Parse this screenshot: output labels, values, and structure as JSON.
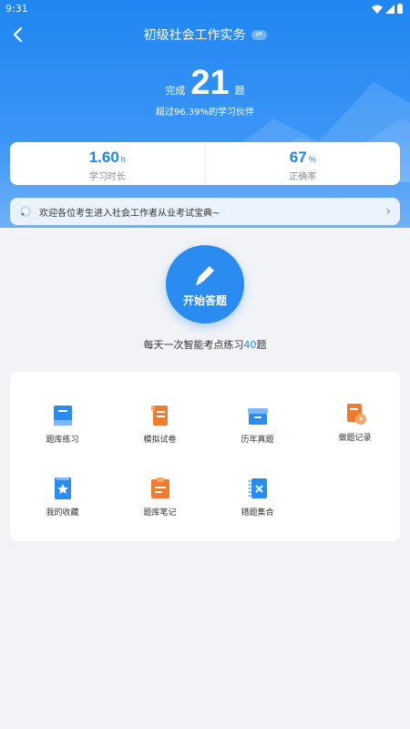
{
  "status_bar": {
    "time": "9:31"
  },
  "header": {
    "title": "初级社会工作实务",
    "swap_icon": "⇌"
  },
  "progress": {
    "prefix": "完成",
    "count": "21",
    "suffix": "题",
    "beat_text": "超过96.39%的学习伙伴"
  },
  "stats": [
    {
      "value": "1.60",
      "unit": "h",
      "label": "学习时长"
    },
    {
      "value": "67",
      "unit": "%",
      "label": "正确率"
    }
  ],
  "notice": {
    "text": "欢迎各位考生进入社会工作者从业考试宝典~"
  },
  "start": {
    "label": "开始答题",
    "daily_prefix": "每天一次智能考点练习",
    "daily_count": "40",
    "daily_suffix": "题"
  },
  "menu": [
    {
      "label": "题库练习",
      "icon": "book-icon"
    },
    {
      "label": "模拟试卷",
      "icon": "scroll-icon"
    },
    {
      "label": "历年真题",
      "icon": "archive-box-icon"
    },
    {
      "label": "做题记录",
      "icon": "record-clock-icon"
    },
    {
      "label": "我的收藏",
      "icon": "star-bookmark-icon"
    },
    {
      "label": "题库笔记",
      "icon": "notes-icon"
    },
    {
      "label": "错题集合",
      "icon": "wrong-answers-icon"
    }
  ],
  "colors": {
    "primary": "#2a8bf0",
    "orange": "#f17b2c",
    "background": "#f1f3f6"
  }
}
